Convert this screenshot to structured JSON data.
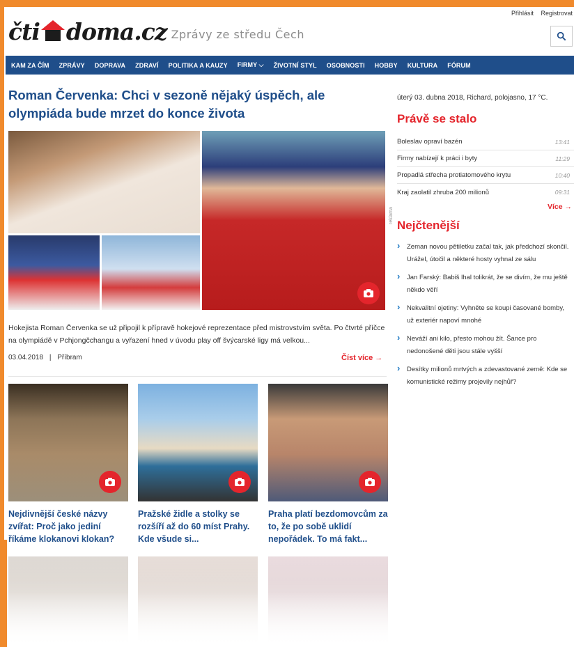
{
  "header": {
    "login": "Přihlásit",
    "register": "Registrovat",
    "logo_part1": "čti",
    "logo_part2": "doma.cz",
    "tagline": "Zprávy ze středu Čech",
    "search_icon": "search-icon"
  },
  "nav": {
    "items": [
      {
        "label": "KAM ZA ČÍM"
      },
      {
        "label": "ZPRÁVY"
      },
      {
        "label": "DOPRAVA"
      },
      {
        "label": "ZDRAVÍ"
      },
      {
        "label": "POLITIKA A KAUZY"
      },
      {
        "label": "FIRMY ⌵"
      },
      {
        "label": "ŽIVOTNÍ STYL"
      },
      {
        "label": "OSOBNOSTI"
      },
      {
        "label": "HOBBY"
      },
      {
        "label": "KULTURA"
      },
      {
        "label": "FÓRUM"
      }
    ]
  },
  "main": {
    "headline": "Roman Červenka: Chci v sezoně nějaký úspěch, ale olympiáda bude mrzet do konce života",
    "summary": "Hokejista Roman Červenka se už připojil k přípravě hokejové reprezentace před mistrovstvím světa. Po čtvrté příčce na olympiádě v Pchjongčchangu a vyřazení hned v úvodu play off švýcarské ligy má velkou...",
    "date": "03.04.2018",
    "separator": "|",
    "location": "Příbram",
    "read_more": "Číst více →"
  },
  "cards": [
    {
      "title": "Nejdivnější české názvy zvířat: Proč jako jediní říkáme klokanovi klokan?"
    },
    {
      "title": "Pražské židle a stolky se rozšíří až do 60 míst Prahy. Kde všude si..."
    },
    {
      "title": "Praha platí bezdomovcům za to, že po sobě uklidí nepořádek. To má fakt..."
    }
  ],
  "sidebar": {
    "dateline": "úterý 03. dubna 2018, Richard, polojasno, 17 °C.",
    "just_happened_title": "Právě se stalo",
    "news": [
      {
        "title": "Boleslav opraví bazén",
        "time": "13:41"
      },
      {
        "title": "Firmy nabízejí k práci i byty",
        "time": "11:29"
      },
      {
        "title": "Propadlá střecha protiatomového krytu",
        "time": "10:40"
      },
      {
        "title": "Kraj zaolatil zhruba 200 milionů",
        "time": "09:31"
      }
    ],
    "more": "Více →",
    "ad_label": "reklama",
    "most_read_title": "Nejčtenější",
    "most_read": [
      {
        "title": "Zeman novou pětiletku začal tak, jak předchozí skončil. Urážel, útočil a některé hosty vyhnal ze sálu"
      },
      {
        "title": "Jan Farský: Babiš lhal tolikrát, že se divím, že mu ještě někdo věří"
      },
      {
        "title": "Nekvalitní ojetiny: Vyhněte se koupi časované bomby, už exteriér napoví mnohé"
      },
      {
        "title": "Neváží ani kilo, přesto mohou žít. Šance pro nedonošené děti jsou stále vyšší"
      },
      {
        "title": "Desítky milionů mrtvých a zdevastované země: Kde se komunistické režimy projevily nejhůř?"
      }
    ]
  },
  "colors": {
    "accent_blue": "#1f4e8a",
    "accent_red": "#e4252c",
    "frame_orange": "#f08a2c"
  }
}
